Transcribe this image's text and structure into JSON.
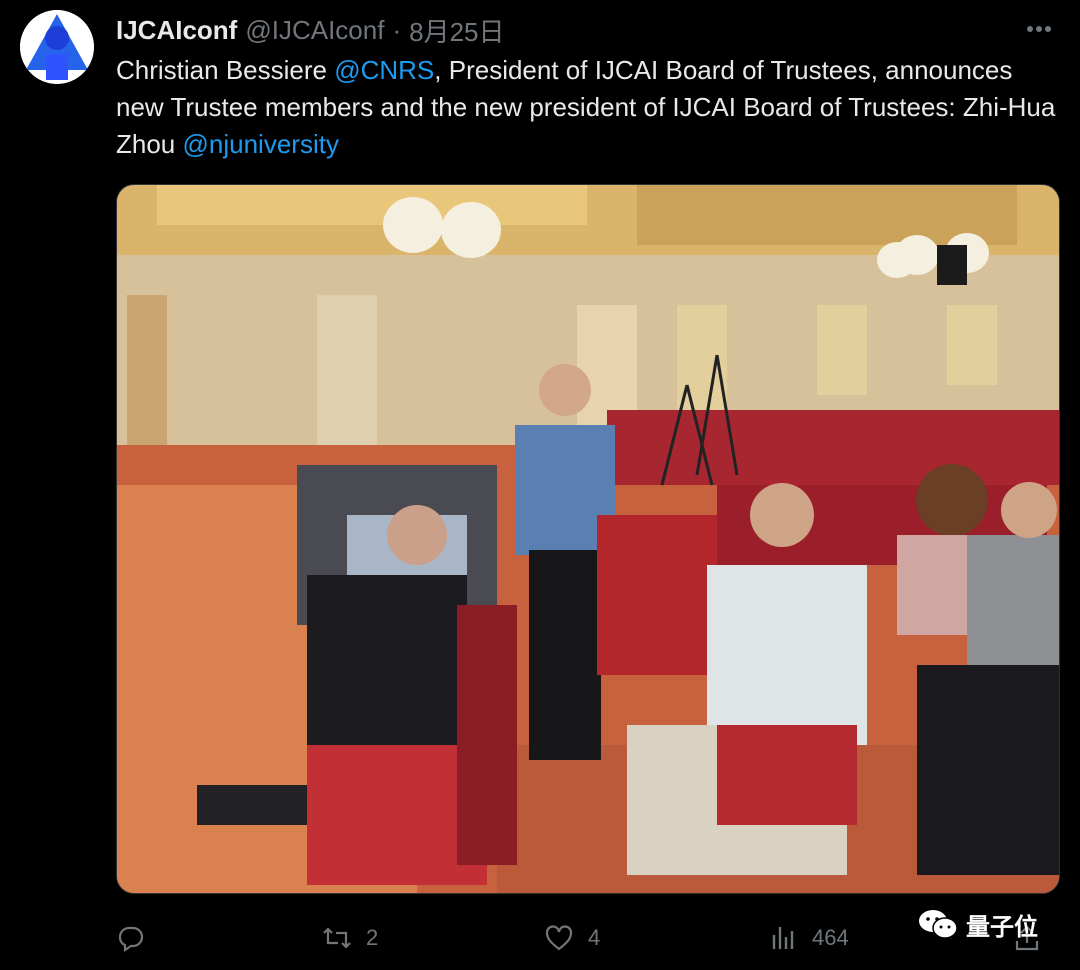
{
  "author": {
    "name": "IJCAIconf",
    "handle": "@IJCAIconf",
    "separator": "·",
    "date": "8月25日"
  },
  "more_icon": "more-horizontal-icon",
  "tweet": {
    "segments": [
      {
        "text": "Christian Bessiere ",
        "type": "text"
      },
      {
        "text": "@CNRS",
        "type": "mention"
      },
      {
        "text": ", President of IJCAI Board of Trustees, announces new Trustee members and the new president of IJCAI Board of Trustees: Zhi-Hua Zhou ",
        "type": "text"
      },
      {
        "text": "@njuniversity",
        "type": "mention"
      }
    ]
  },
  "actions": {
    "reply": {
      "icon": "reply-icon",
      "count": ""
    },
    "retweet": {
      "icon": "retweet-icon",
      "count": "2"
    },
    "like": {
      "icon": "heart-icon",
      "count": "4"
    },
    "views": {
      "icon": "views-icon",
      "count": "464"
    },
    "share": {
      "icon": "share-icon"
    }
  },
  "watermark": {
    "icon": "wechat-icon",
    "label": "量子位"
  },
  "colors": {
    "mention": "#1d9bf0",
    "muted": "#71767b",
    "text": "#e7e9ea",
    "background": "#000000"
  }
}
